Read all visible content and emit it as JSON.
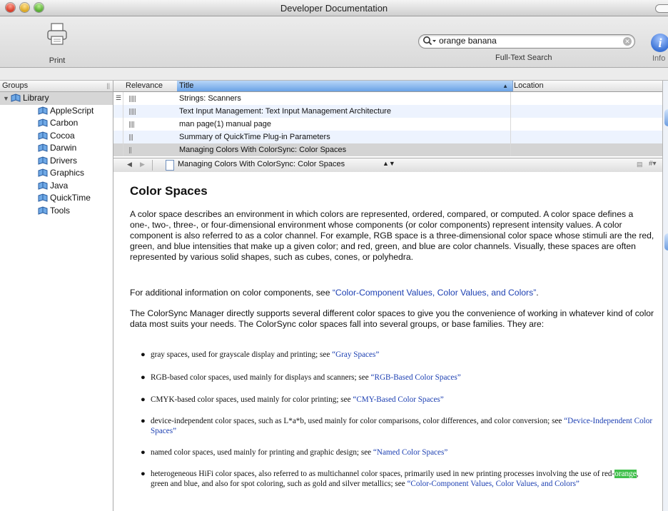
{
  "window": {
    "title": "Developer Documentation"
  },
  "toolbar": {
    "print_label": "Print",
    "search_value": "orange banana",
    "search_label": "Full-Text Search",
    "info_label": "Info",
    "info_glyph": "i"
  },
  "groups": {
    "header": "Groups",
    "root": "Library",
    "items": [
      "AppleScript",
      "Carbon",
      "Cocoa",
      "Darwin",
      "Drivers",
      "Graphics",
      "Java",
      "QuickTime",
      "Tools"
    ]
  },
  "results": {
    "columns": [
      "Relevance",
      "Title",
      "Location"
    ],
    "rows": [
      {
        "title": "Strings: Scanners",
        "relevance": 0.8,
        "location": ""
      },
      {
        "title": "Text Input Management: Text Input Management Architecture",
        "relevance": 0.75,
        "location": ""
      },
      {
        "title": "man page(1) manual page",
        "relevance": 0.6,
        "location": ""
      },
      {
        "title": "Summary of QuickTime Plug-in Parameters",
        "relevance": 0.5,
        "location": ""
      },
      {
        "title": "Managing Colors With ColorSync: Color Spaces",
        "relevance": 0.4,
        "location": "",
        "selected": true
      }
    ]
  },
  "nav": {
    "title": "Managing Colors With ColorSync: Color Spaces",
    "back_icon": "back-arrow-icon",
    "forward_icon": "forward-arrow-icon"
  },
  "document": {
    "title": "Color Spaces",
    "p1": "A color space describes an environment in which colors are represented, ordered, compared, or computed. A color space defines a one-, two-, three-, or four-dimensional environment whose components (or color components) represent intensity values. A color component is also referred to as a color channel. For example, RGB space is a three-dimensional color space whose stimuli are the red, green, and blue intensities that make up a given color; and red, green, and blue are color channels. Visually, these spaces are often represented by various solid shapes, such as cubes, cones, or polyhedra.",
    "p2_prefix": "For additional information on color components, see ",
    "p2_link": "“Color-Component Values, Color Values, and Colors”",
    "p2_suffix": ".",
    "p3": "The ColorSync Manager directly supports several different color spaces to give you the convenience of working in whatever kind of color data most suits your needs. The ColorSync color spaces fall into several groups, or base families. They are:",
    "bullets": [
      {
        "text": "gray spaces, used for grayscale display and printing; see ",
        "link": "“Gray Spaces”"
      },
      {
        "text": "RGB-based color spaces, used mainly for displays and scanners; see ",
        "link": "“RGB-Based Color Spaces”"
      },
      {
        "text": "CMYK-based color spaces, used mainly for color printing; see ",
        "link": "“CMY-Based Color Spaces”"
      },
      {
        "text": "device-independent color spaces, such as L*a*b, used mainly for color comparisons, color differences, and color conversion; see ",
        "link": "“Device-Independent Color Spaces”"
      },
      {
        "text": "named color spaces, used mainly for printing and graphic design; see ",
        "link": "“Named Color Spaces”"
      },
      {
        "text_a": "heterogeneous HiFi color spaces, also referred to as multichannel color spaces, primarily used in new printing processes involving the use of red-",
        "highlight": "orange",
        "text_b": ", green and blue, and also for spot coloring, such as gold and silver metallics; see ",
        "link": "“Color-Component Values, Color Values, and Colors”"
      }
    ]
  },
  "colors": {
    "link": "#1c3fb2",
    "search_highlight": "#3fbf4a",
    "selected_row": "#d4d4d4",
    "alt_row": "#edf3fe"
  }
}
